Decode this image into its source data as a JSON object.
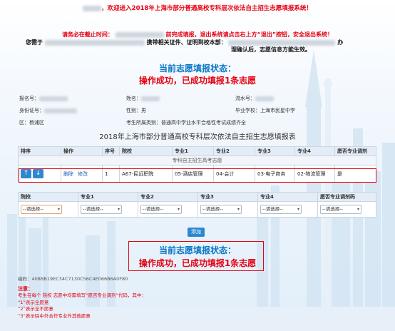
{
  "header": {
    "welcome": "，欢迎进入2018年上海市部分普通高校专科层次依法自主招生志愿填报系统！",
    "warning_label": "请务必在截止时间：",
    "warning_text": "前完成填报，退出系统请点击右上方“退出”按钮，安全退出系统！",
    "notice_line1_a": "您需于",
    "notice_line1_b": "携带相关证件、证明到校本部：",
    "notice_line1_c": "办",
    "notice_line2": "理确认后，志愿信息方能生效。"
  },
  "status": {
    "title": "当前志愿填报状态：",
    "message": "操作成功，已成功填报1条志愿"
  },
  "info": {
    "exam_no_label": "报名号：",
    "name_label": "姓名：",
    "serial_label": "流水号：",
    "id_label": "身份证号：",
    "gender_label": "性别：",
    "gender_value": "男",
    "school_label": "毕业学校：",
    "school_value": "上海市民星中学",
    "district_label": "区：",
    "district_value": "杨浦区",
    "category_label": "考生所属类别：",
    "category_value": "普通高中学业水平合格性考试成绩齐全"
  },
  "section_title": "2018年上海市部分普通高校专科层次依法自主招生志愿填报表",
  "table": {
    "headers": [
      "排序",
      "操作",
      "序号",
      "院校",
      "专业1",
      "专业2",
      "专业3",
      "专业4",
      "愿否专业调剂"
    ],
    "subheader": "专科自主招生高考志愿",
    "row": {
      "up": "↑",
      "down": "↓",
      "delete": "删除",
      "edit": "修改",
      "index": "1",
      "school": "A67-民远职院",
      "major1": "05-酒店管理",
      "major2": "04-会计",
      "major3": "03-电子商务",
      "major4": "02-物流管理",
      "adjust": "是"
    }
  },
  "form": {
    "headers": [
      "院校",
      "专业1",
      "专业2",
      "专业3",
      "专业4",
      "愿否专业调剂码"
    ],
    "placeholder": "--请选择--",
    "add_label": "添加"
  },
  "footer": {
    "code_label": "编码：",
    "code_value": "408BB19EC34C7130C56C4E066B6A0F80",
    "note_title": "注意：",
    "note1": "考生在每个 院校 志愿中均需填写“愿否专业调剂”代码，其中：",
    "note2": "“1”表示全愿意",
    "note3": "“2”表示全不愿意",
    "note4": "“3”表示除中外合作专业外其他愿意"
  },
  "colors": {
    "accent": "#0a77c7",
    "alert": "#e60012",
    "button": "#2f88cf"
  }
}
